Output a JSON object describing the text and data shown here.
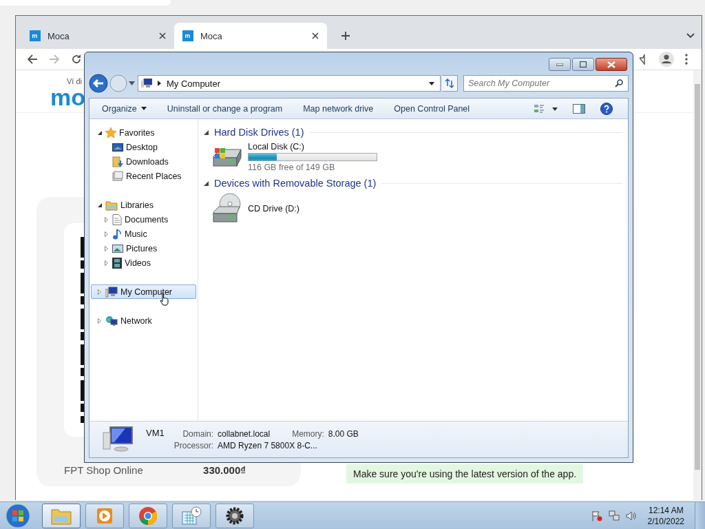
{
  "browser": {
    "tabs": [
      {
        "title": "Moca",
        "selected": false
      },
      {
        "title": "Moca",
        "selected": true
      }
    ],
    "page": {
      "tagline": "Ví đi",
      "logo": "mo",
      "shop": "FPT Shop Online",
      "price": "330.000₫",
      "notice": "Make sure you're using the latest version of the app."
    }
  },
  "explorer": {
    "address": "My Computer",
    "search": {
      "placeholder": "Search My Computer"
    },
    "toolbar": [
      {
        "label": "Organize",
        "dropdown": true
      },
      {
        "label": "Uninstall or change a program",
        "dropdown": false
      },
      {
        "label": "Map network drive",
        "dropdown": false
      },
      {
        "label": "Open Control Panel",
        "dropdown": false
      }
    ],
    "nav": [
      {
        "label": "Favorites",
        "kind": "star",
        "expanded": true,
        "selected": false,
        "children": [
          {
            "label": "Desktop",
            "kind": "desktop",
            "selected": false
          },
          {
            "label": "Downloads",
            "kind": "downloads",
            "selected": false
          },
          {
            "label": "Recent Places",
            "kind": "recent",
            "selected": false
          }
        ]
      },
      {
        "label": "Libraries",
        "kind": "library",
        "expanded": true,
        "selected": false,
        "children": [
          {
            "label": "Documents",
            "kind": "document",
            "expanded": false,
            "selected": false
          },
          {
            "label": "Music",
            "kind": "music",
            "expanded": false,
            "selected": false
          },
          {
            "label": "Pictures",
            "kind": "pictures",
            "expanded": false,
            "selected": false
          },
          {
            "label": "Videos",
            "kind": "video",
            "expanded": false,
            "selected": false
          }
        ]
      },
      {
        "label": "My Computer",
        "kind": "computer",
        "expanded": false,
        "selected": true
      },
      {
        "label": "Network",
        "kind": "network",
        "expanded": false,
        "selected": false
      }
    ],
    "groups": [
      {
        "title": "Hard Disk Drives (1)",
        "expanded": true,
        "items": [
          {
            "name": "Local Disk (C:)",
            "kind": "disk",
            "level": 0.22,
            "free": "116 GB free of 149 GB"
          }
        ]
      },
      {
        "title": "Devices with Removable Storage (1)",
        "expanded": true,
        "items": [
          {
            "name": "CD Drive (D:)",
            "kind": "cd"
          }
        ]
      }
    ],
    "details": {
      "name": "VM1",
      "fields": [
        {
          "label": "Domain:",
          "value": "collabnet.local"
        },
        {
          "label": "Memory:",
          "value": "8.00 GB"
        },
        {
          "label": "Processor:",
          "value": "AMD Ryzen 7 5800X 8-C..."
        }
      ]
    }
  },
  "taskbar": {
    "apps": [
      {
        "kind": "folder",
        "selected": true
      },
      {
        "kind": "media",
        "selected": false
      },
      {
        "kind": "browser",
        "selected": false
      },
      {
        "kind": "calendar",
        "selected": false
      },
      {
        "kind": "gear",
        "selected": false
      }
    ],
    "time": "12:14 AM",
    "date": "2/10/2022"
  }
}
